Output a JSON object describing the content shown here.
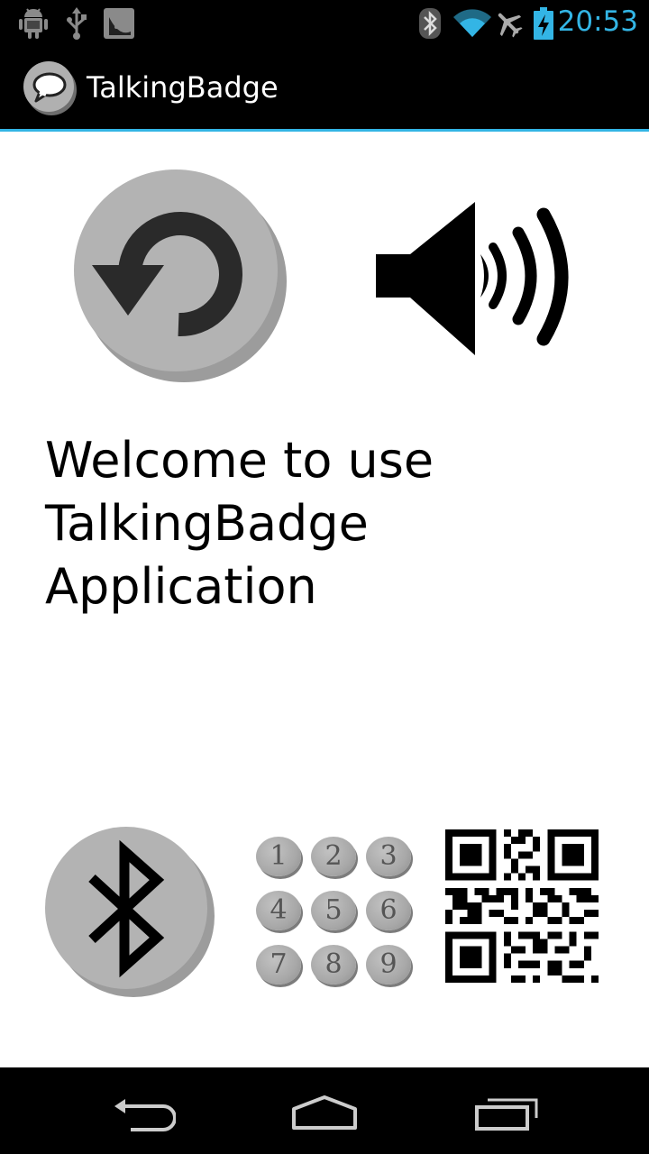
{
  "status_bar": {
    "time": "20:53",
    "left_icons": [
      "android-debug-icon",
      "usb-icon",
      "app-notification-icon"
    ],
    "right_icons": [
      "bluetooth-icon",
      "wifi-icon",
      "airplane-icon",
      "battery-charging-icon"
    ],
    "accent_color": "#33b5e5"
  },
  "action_bar": {
    "title": "TalkingBadge",
    "icon": "chat-bubble-icon"
  },
  "main": {
    "welcome_text": "Welcome to use TalkingBadge Application",
    "top_buttons": [
      "refresh-icon",
      "speaker-icon"
    ],
    "bottom_buttons": [
      "bluetooth-icon",
      "keypad-icon",
      "qr-code-icon"
    ],
    "keypad_digits": [
      "1",
      "2",
      "3",
      "4",
      "5",
      "6",
      "7",
      "8",
      "9"
    ]
  },
  "nav_bar": {
    "buttons": [
      "back-icon",
      "home-icon",
      "recent-apps-icon"
    ]
  }
}
